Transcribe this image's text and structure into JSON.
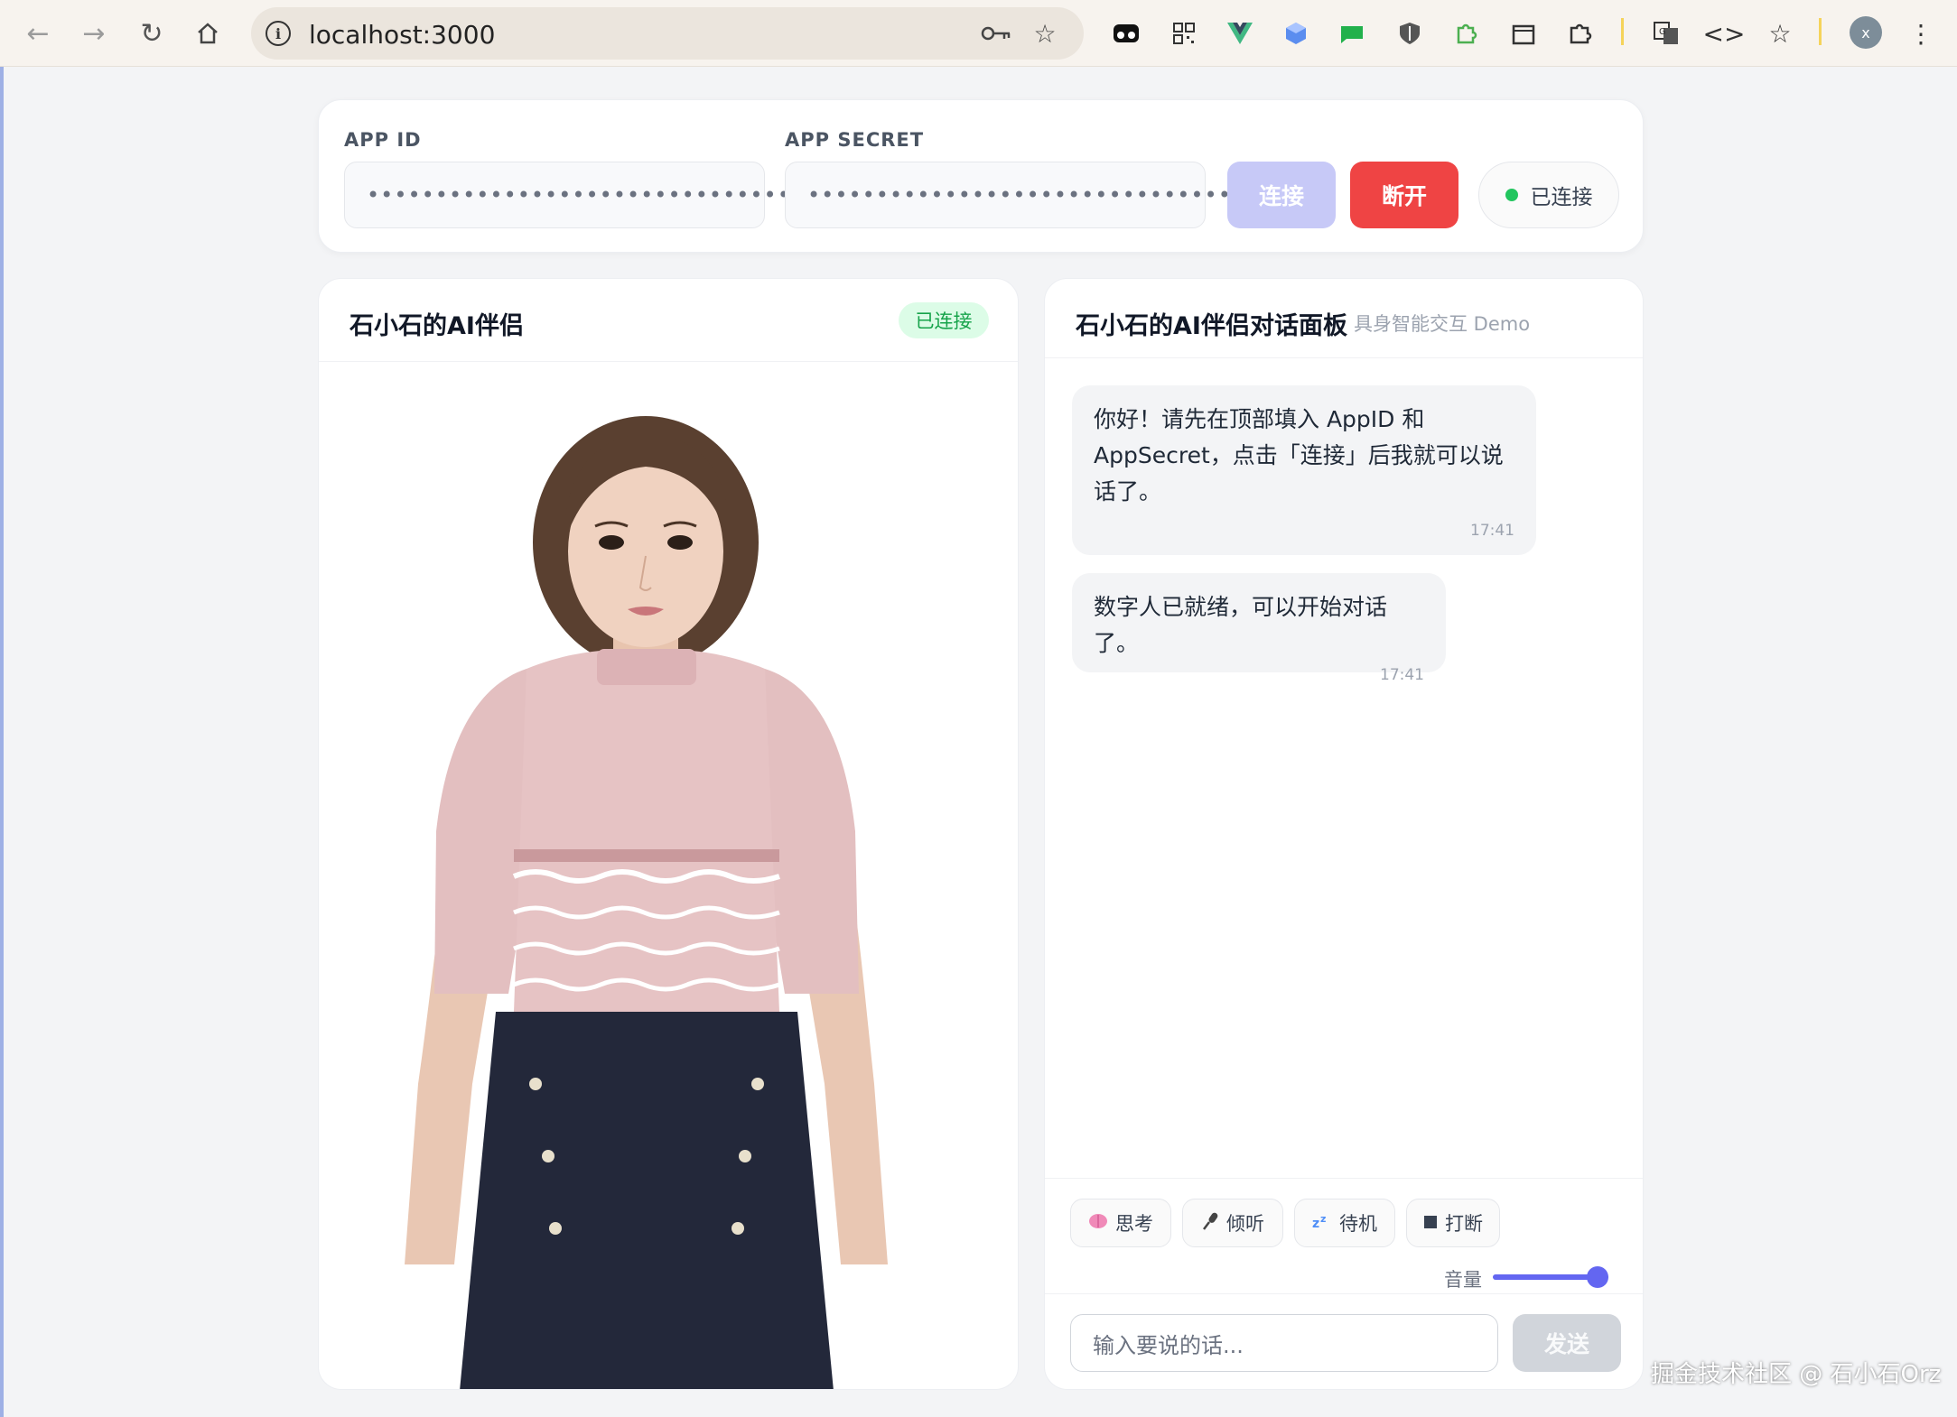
{
  "browser": {
    "url": "localhost:3000",
    "profile_initial": "x"
  },
  "credentials": {
    "app_id_label": "APP ID",
    "app_id_value": "••••••••••••••••••••••••••••••••",
    "app_secret_label": "APP SECRET",
    "app_secret_value": "••••••••••••••••••••••••••••••••",
    "connect_label": "连接",
    "disconnect_label": "断开",
    "status_label": "已连接"
  },
  "avatar_panel": {
    "title": "石小石的AI伴侣",
    "badge": "已连接"
  },
  "chat_panel": {
    "title": "石小石的AI伴侣对话面板",
    "subtitle": "具身智能交互 Demo",
    "messages": [
      {
        "text": "你好！请先在顶部填入 AppID 和 AppSecret，点击「连接」后我就可以说话了。",
        "time": "17:41"
      },
      {
        "text": "数字人已就绪，可以开始对话了。",
        "time": "17:41"
      }
    ],
    "controls": [
      {
        "icon": "brain-icon",
        "label": "思考"
      },
      {
        "icon": "microphone-icon",
        "label": "倾听"
      },
      {
        "icon": "sleep-icon",
        "label": "待机"
      },
      {
        "icon": "stop-icon",
        "label": "打断"
      }
    ],
    "volume_label": "音量",
    "volume_level": 1.0,
    "input_placeholder": "输入要说的话...",
    "send_label": "发送"
  },
  "watermark": "掘金技术社区 @ 石小石Orz",
  "colors": {
    "accent": "#6366f1",
    "danger": "#ef4444",
    "success": "#22c55e",
    "connect_disabled": "#c7c9f7"
  }
}
